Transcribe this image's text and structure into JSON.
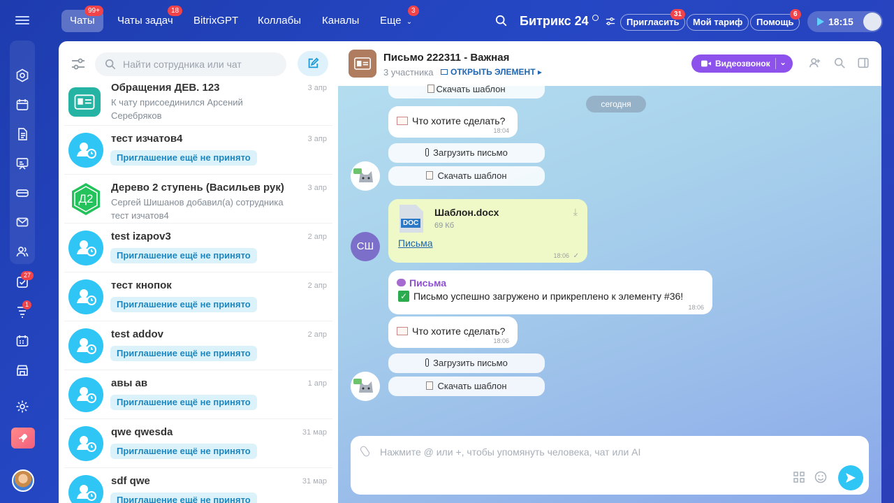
{
  "topbar": {
    "tabs": [
      {
        "label": "Чаты",
        "badge": "99+"
      },
      {
        "label": "Чаты задач",
        "badge": "18"
      },
      {
        "label": "BitrixGPT",
        "badge": ""
      },
      {
        "label": "Коллабы",
        "badge": ""
      },
      {
        "label": "Каналы",
        "badge": ""
      },
      {
        "label": "Еще",
        "badge": "3"
      }
    ],
    "logo": "Битрикс 24",
    "invite_label": "Пригласить",
    "invite_badge": "31",
    "tariff_label": "Мой тариф",
    "help_label": "Помощь",
    "help_badge": "6",
    "time": "18:15"
  },
  "rail": {
    "tasks_badge": "27",
    "filter_badge": "1"
  },
  "chatlist": {
    "search_placeholder": "Найти сотрудника или чат",
    "items": [
      {
        "name": "Обращения ДЕВ. 123",
        "date": "3 апр",
        "sub": "К чату присоединился Арсений Серебряков",
        "invite": ""
      },
      {
        "name": "тест изчатов4",
        "date": "3 апр",
        "sub": "",
        "invite": "Приглашение ещё не принято"
      },
      {
        "name": "Дерево 2 ступень (Васильев рук)",
        "date": "3 апр",
        "sub": "Сергей Шишанов добавил(а) сотрудника тест изчатов4",
        "invite": "",
        "avatar_text": "Д2"
      },
      {
        "name": "test izapov3",
        "date": "2 апр",
        "sub": "",
        "invite": "Приглашение ещё не принято"
      },
      {
        "name": "тест кнопок",
        "date": "2 апр",
        "sub": "",
        "invite": "Приглашение ещё не принято"
      },
      {
        "name": "test addov",
        "date": "2 апр",
        "sub": "",
        "invite": "Приглашение ещё не принято"
      },
      {
        "name": "авы ав",
        "date": "1 апр",
        "sub": "",
        "invite": "Приглашение ещё не принято"
      },
      {
        "name": "qwe qwesda",
        "date": "31 мар",
        "sub": "",
        "invite": "Приглашение ещё не принято"
      },
      {
        "name": "sdf qwe",
        "date": "31 мар",
        "sub": "",
        "invite": "Приглашение ещё не принято"
      }
    ]
  },
  "chat": {
    "title": "Письмо 222311 - Важная",
    "participants": "3 участника",
    "open_element": "ОТКРЫТЬ ЭЛЕМЕНТ",
    "video_call": "Видеозвонок",
    "today": "сегодня",
    "download_template": "Скачать шаблон",
    "upload_letter": "Загрузить письмо",
    "question": "Что хотите сделать?",
    "question_time_1": "18:04",
    "question_time_2": "18:06",
    "file_name": "Шаблон.docx",
    "file_size": "69 Кб",
    "file_ext": "DOC",
    "file_link": "Письма",
    "file_time": "18:06",
    "sender_initials": "СШ",
    "bot_name": "Письма",
    "bot_text": "Письмо успешно загружено и прикреплено к элементу #36!",
    "bot_time": "18:06",
    "composer_placeholder": "Нажмите @ или +, чтобы упомянуть человека, чат или AI"
  }
}
